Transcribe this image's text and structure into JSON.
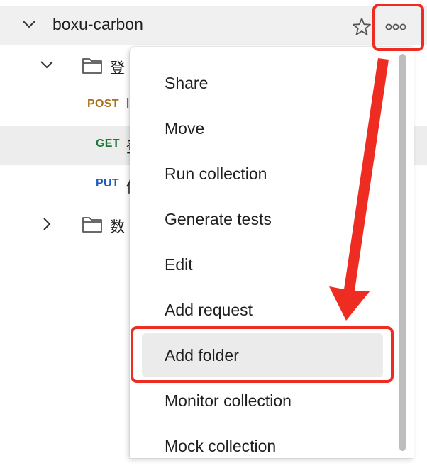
{
  "sidebar": {
    "collection": {
      "name": "boxu-carbon",
      "expanded": true
    },
    "folder1": {
      "name_visible": "登",
      "expanded": true
    },
    "requests": [
      {
        "method": "POST",
        "label_visible": "l"
      },
      {
        "method": "GET",
        "label_visible": "登"
      },
      {
        "method": "PUT",
        "label_visible": "修"
      }
    ],
    "folder2": {
      "name_visible": "数",
      "expanded": false
    }
  },
  "context_menu": {
    "items": [
      "Share",
      "Move",
      "Run collection",
      "Generate tests",
      "Edit",
      "Add request",
      "Add folder",
      "Monitor collection",
      "Mock collection"
    ],
    "highlighted": "Add folder"
  },
  "icons": {
    "expand": "chevron-down-icon",
    "collapse": "chevron-right-icon",
    "folder": "folder-icon",
    "star": "star-icon",
    "more": "more-horizontal-icon"
  },
  "colors": {
    "post": "#a8701f",
    "get": "#1f7a3a",
    "put": "#1f5ac4",
    "annotation": "#ee2c22"
  }
}
